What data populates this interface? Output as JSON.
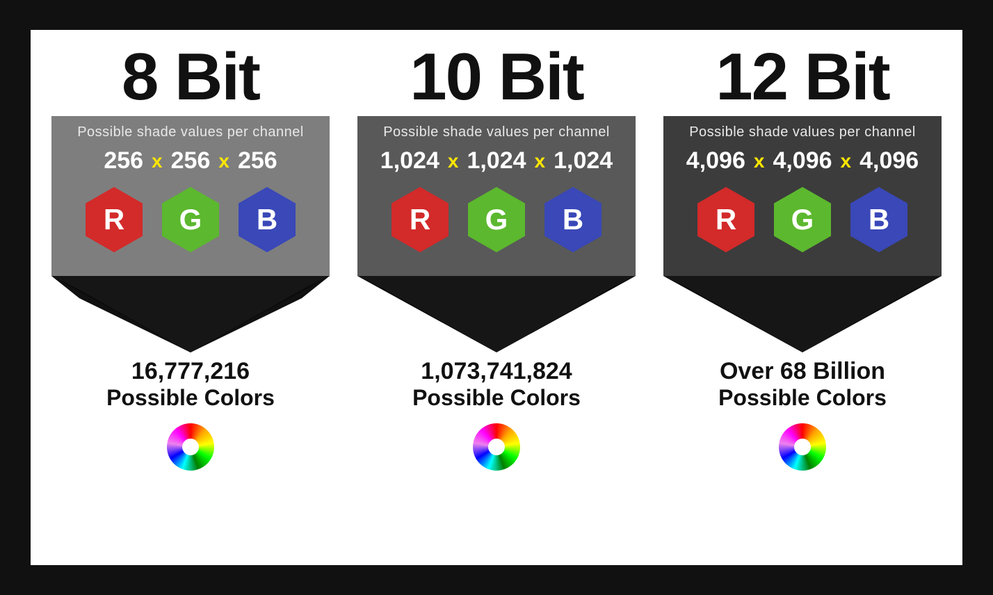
{
  "columns": [
    {
      "title": "8 Bit",
      "subhead": "Possible shade values per channel",
      "values": [
        "256",
        "256",
        "256"
      ],
      "result_number": "16,777,216",
      "result_label": "Possible Colors"
    },
    {
      "title": "10 Bit",
      "subhead": "Possible shade values per channel",
      "values": [
        "1,024",
        "1,024",
        "1,024"
      ],
      "result_number": "1,073,741,824",
      "result_label": "Possible Colors"
    },
    {
      "title": "12 Bit",
      "subhead": "Possible shade values per channel",
      "values": [
        "4,096",
        "4,096",
        "4,096"
      ],
      "result_number": "Over 68 Billion",
      "result_label": "Possible Colors"
    }
  ],
  "rgb_badges": [
    "R",
    "G",
    "B"
  ],
  "multiply_symbol": "x"
}
